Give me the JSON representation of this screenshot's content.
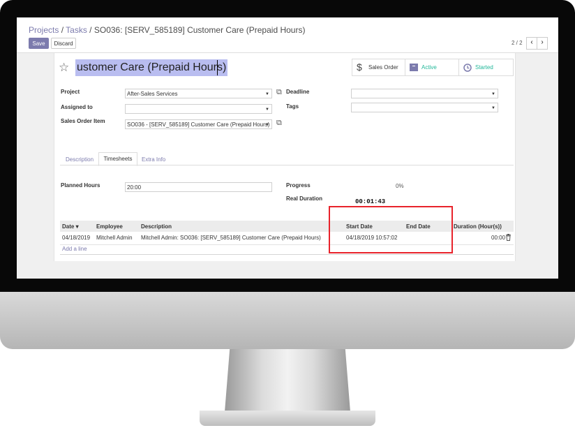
{
  "breadcrumb": {
    "projects": "Projects",
    "sep1": " / ",
    "tasks": "Tasks",
    "sep2": " / ",
    "current": "SO036: [SERV_585189] Customer Care (Prepaid Hours)"
  },
  "toolbar": {
    "save_label": "Save",
    "discard_label": "Discard",
    "pager": "2 / 2",
    "prev_icon": "‹",
    "next_icon": "›"
  },
  "task": {
    "title": "ustomer Care (Prepaid Hours)",
    "star_icon": "☆"
  },
  "smart_buttons": {
    "sales_order": {
      "label": "Sales Order",
      "icon": "$"
    },
    "active": {
      "label": "Active",
      "icon": "archive-icon"
    },
    "started": {
      "label": "Started",
      "icon": "clock-icon"
    }
  },
  "fields": {
    "project_label": "Project",
    "project_value": "After-Sales Services",
    "assigned_label": "Assigned to",
    "assigned_value": "",
    "soitem_label": "Sales Order Item",
    "soitem_value": "SO036 - [SERV_585189] Customer Care (Prepaid Hours)",
    "deadline_label": "Deadline",
    "deadline_value": "",
    "tags_label": "Tags",
    "tags_value": ""
  },
  "tabs": {
    "description": "Description",
    "timesheets": "Timesheets",
    "extra": "Extra Info"
  },
  "timesheet": {
    "planned_label": "Planned Hours",
    "planned_value": "20:00",
    "progress_label": "Progress",
    "progress_value": "0%",
    "real_label": "Real Duration",
    "real_value": "00:01:43",
    "columns": {
      "date": "Date",
      "employee": "Employee",
      "description": "Description",
      "start": "Start Date",
      "end": "End Date",
      "duration": "Duration (Hour(s))"
    },
    "row": {
      "date": "04/18/2019",
      "employee": "Mitchell Admin",
      "description": "Mitchell Admin: SO036: [SERV_585189] Customer Care (Prepaid Hours)",
      "start": "04/18/2019 10:57:02",
      "end": "",
      "duration": "00:00"
    },
    "add_line": "Add a line"
  },
  "colors": {
    "accent": "#7c7bad",
    "highlight": "#e8232b",
    "status_green": "#21b799"
  }
}
